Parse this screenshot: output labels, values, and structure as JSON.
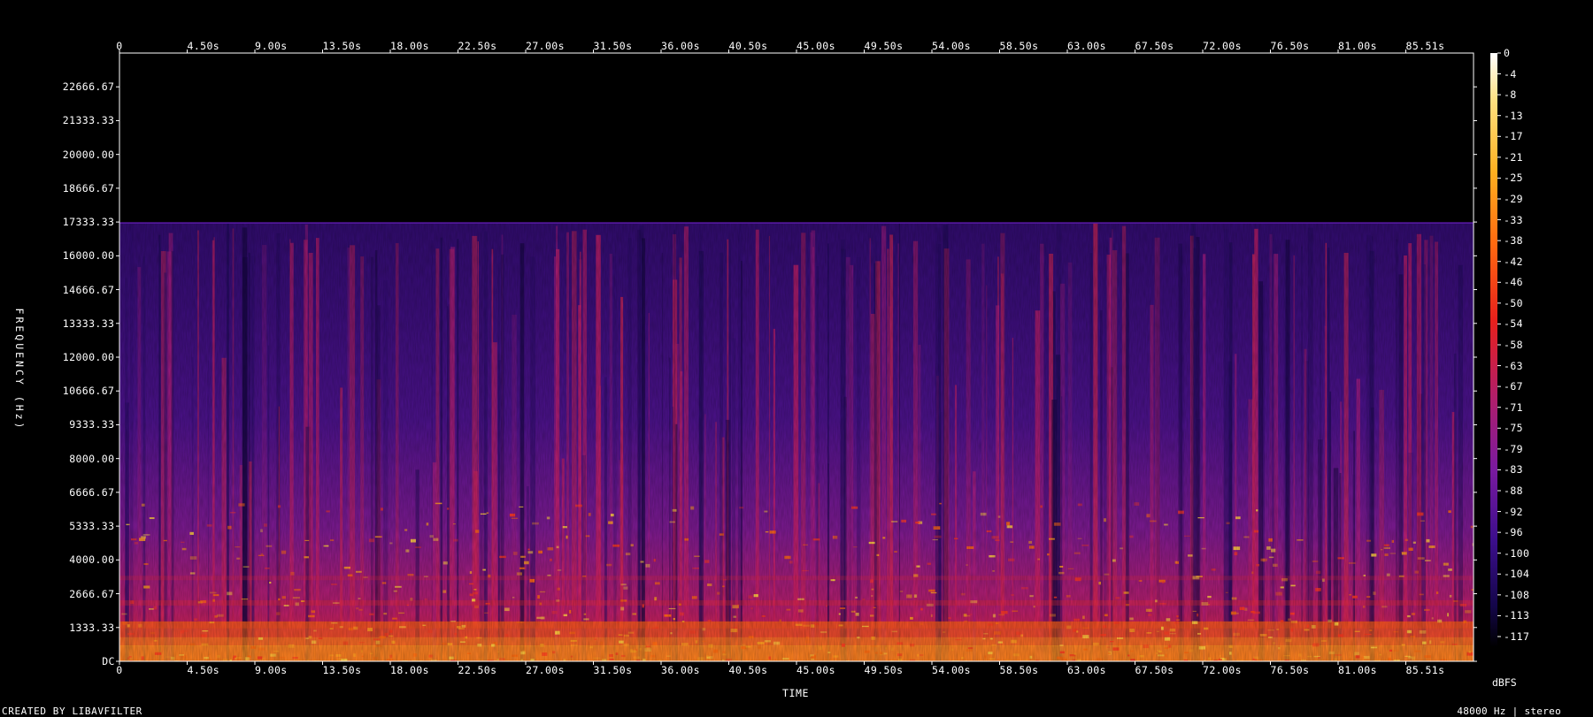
{
  "chart_data": {
    "type": "heatmap",
    "xlabel": "TIME",
    "ylabel": "FREQUENCY (Hz)",
    "x_ticks": [
      "0",
      "4.50s",
      "9.00s",
      "13.50s",
      "18.00s",
      "22.50s",
      "27.00s",
      "31.50s",
      "36.00s",
      "40.50s",
      "45.00s",
      "49.50s",
      "54.00s",
      "58.50s",
      "63.00s",
      "67.50s",
      "72.00s",
      "76.50s",
      "81.00s",
      "85.51s"
    ],
    "y_ticks": [
      "DC",
      "1333.33",
      "2666.67",
      "4000.00",
      "5333.33",
      "6666.67",
      "8000.00",
      "9333.33",
      "10666.67",
      "12000.00",
      "13333.33",
      "14666.67",
      "16000.00",
      "17333.33",
      "18666.67",
      "20000.00",
      "21333.33",
      "22666.67"
    ],
    "colorbar": {
      "unit": "dBFS",
      "ticks": [
        "0",
        "-4",
        "-8",
        "-13",
        "-17",
        "-21",
        "-25",
        "-29",
        "-33",
        "-38",
        "-42",
        "-46",
        "-50",
        "-54",
        "-58",
        "-63",
        "-67",
        "-71",
        "-75",
        "-79",
        "-83",
        "-88",
        "-92",
        "-96",
        "-100",
        "-104",
        "-108",
        "-113",
        "-117"
      ]
    },
    "xlim_seconds": [
      0,
      90
    ],
    "ylim_hz": [
      0,
      24000
    ],
    "spectral_cutoff_hz": 17300,
    "colormap": [
      "#000000",
      "#1a0850",
      "#3c0e8c",
      "#6a1a9e",
      "#9c1f90",
      "#d0206c",
      "#f0242c",
      "#ff5a10",
      "#ff9a1a",
      "#ffd040",
      "#ffffff"
    ]
  },
  "footer": {
    "credit": "CREATED BY LIBAVFILTER",
    "sample_rate": "48000 Hz | stereo"
  }
}
